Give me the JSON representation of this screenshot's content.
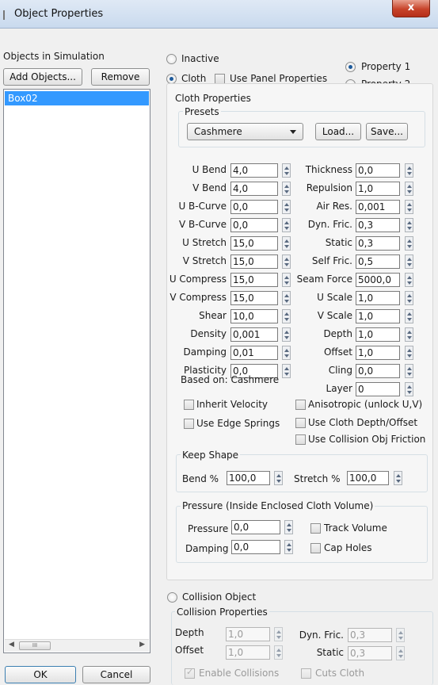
{
  "window": {
    "title": "Object Properties",
    "close": "x"
  },
  "objects": {
    "header": "Objects in Simulation",
    "add_label": "Add Objects...",
    "remove_label": "Remove",
    "items": [
      "Box02"
    ],
    "scroll_thumb": "III"
  },
  "mode": {
    "inactive": "Inactive",
    "cloth": "Cloth",
    "use_panel": "Use Panel Properties",
    "property1": "Property 1",
    "property2": "Property 2",
    "selected_mode": "Cloth",
    "selected_property": "Property 1"
  },
  "cloth": {
    "group_title": "Cloth Properties",
    "presets_title": "Presets",
    "preset_value": "Cashmere",
    "load_label": "Load...",
    "save_label": "Save...",
    "left_params": [
      {
        "label": "U Bend",
        "value": "4,0"
      },
      {
        "label": "V Bend",
        "value": "4,0"
      },
      {
        "label": "U B-Curve",
        "value": "0,0"
      },
      {
        "label": "V B-Curve",
        "value": "0,0"
      },
      {
        "label": "U Stretch",
        "value": "15,0"
      },
      {
        "label": "V Stretch",
        "value": "15,0"
      },
      {
        "label": "U Compress",
        "value": "15,0"
      },
      {
        "label": "V Compress",
        "value": "15,0"
      },
      {
        "label": "Shear",
        "value": "10,0"
      },
      {
        "label": "Density",
        "value": "0,001"
      },
      {
        "label": "Damping",
        "value": "0,01"
      },
      {
        "label": "Plasticity",
        "value": "0,0"
      }
    ],
    "right_params": [
      {
        "label": "Thickness",
        "value": "0,0"
      },
      {
        "label": "Repulsion",
        "value": "1,0"
      },
      {
        "label": "Air Res.",
        "value": "0,001"
      },
      {
        "label": "Dyn. Fric.",
        "value": "0,3"
      },
      {
        "label": "Static",
        "value": "0,3"
      },
      {
        "label": "Self Fric.",
        "value": "0,5"
      },
      {
        "label": "Seam Force",
        "value": "5000,0"
      },
      {
        "label": "U Scale",
        "value": "1,0"
      },
      {
        "label": "V Scale",
        "value": "1,0"
      },
      {
        "label": "Depth",
        "value": "1,0"
      },
      {
        "label": "Offset",
        "value": "1,0"
      },
      {
        "label": "Cling",
        "value": "0,0"
      },
      {
        "label": "Layer",
        "value": "0"
      }
    ],
    "based_on": "Based on: Cashmere",
    "inherit_velocity": "Inherit Velocity",
    "use_edge_springs": "Use Edge Springs",
    "anisotropic": "Anisotropic (unlock U,V)",
    "use_depth_offset": "Use Cloth Depth/Offset",
    "use_collision_friction": "Use Collision Obj Friction"
  },
  "keep_shape": {
    "title": "Keep Shape",
    "bend_label": "Bend %",
    "bend_value": "100,0",
    "stretch_label": "Stretch %",
    "stretch_value": "100,0"
  },
  "pressure": {
    "title": "Pressure (Inside Enclosed Cloth Volume)",
    "pressure_label": "Pressure",
    "pressure_value": "0,0",
    "damping_label": "Damping",
    "damping_value": "0,0",
    "track_volume": "Track Volume",
    "cap_holes": "Cap Holes"
  },
  "collision": {
    "radio_label": "Collision Object",
    "group_title": "Collision Properties",
    "depth_label": "Depth",
    "depth_value": "1,0",
    "offset_label": "Offset",
    "offset_value": "1,0",
    "dyn_fric_label": "Dyn. Fric.",
    "dyn_fric_value": "0,3",
    "static_label": "Static",
    "static_value": "0,3",
    "enable_collisions": "Enable Collisions",
    "cuts_cloth": "Cuts Cloth"
  },
  "footer": {
    "ok_label": "OK",
    "cancel_label": "Cancel"
  }
}
